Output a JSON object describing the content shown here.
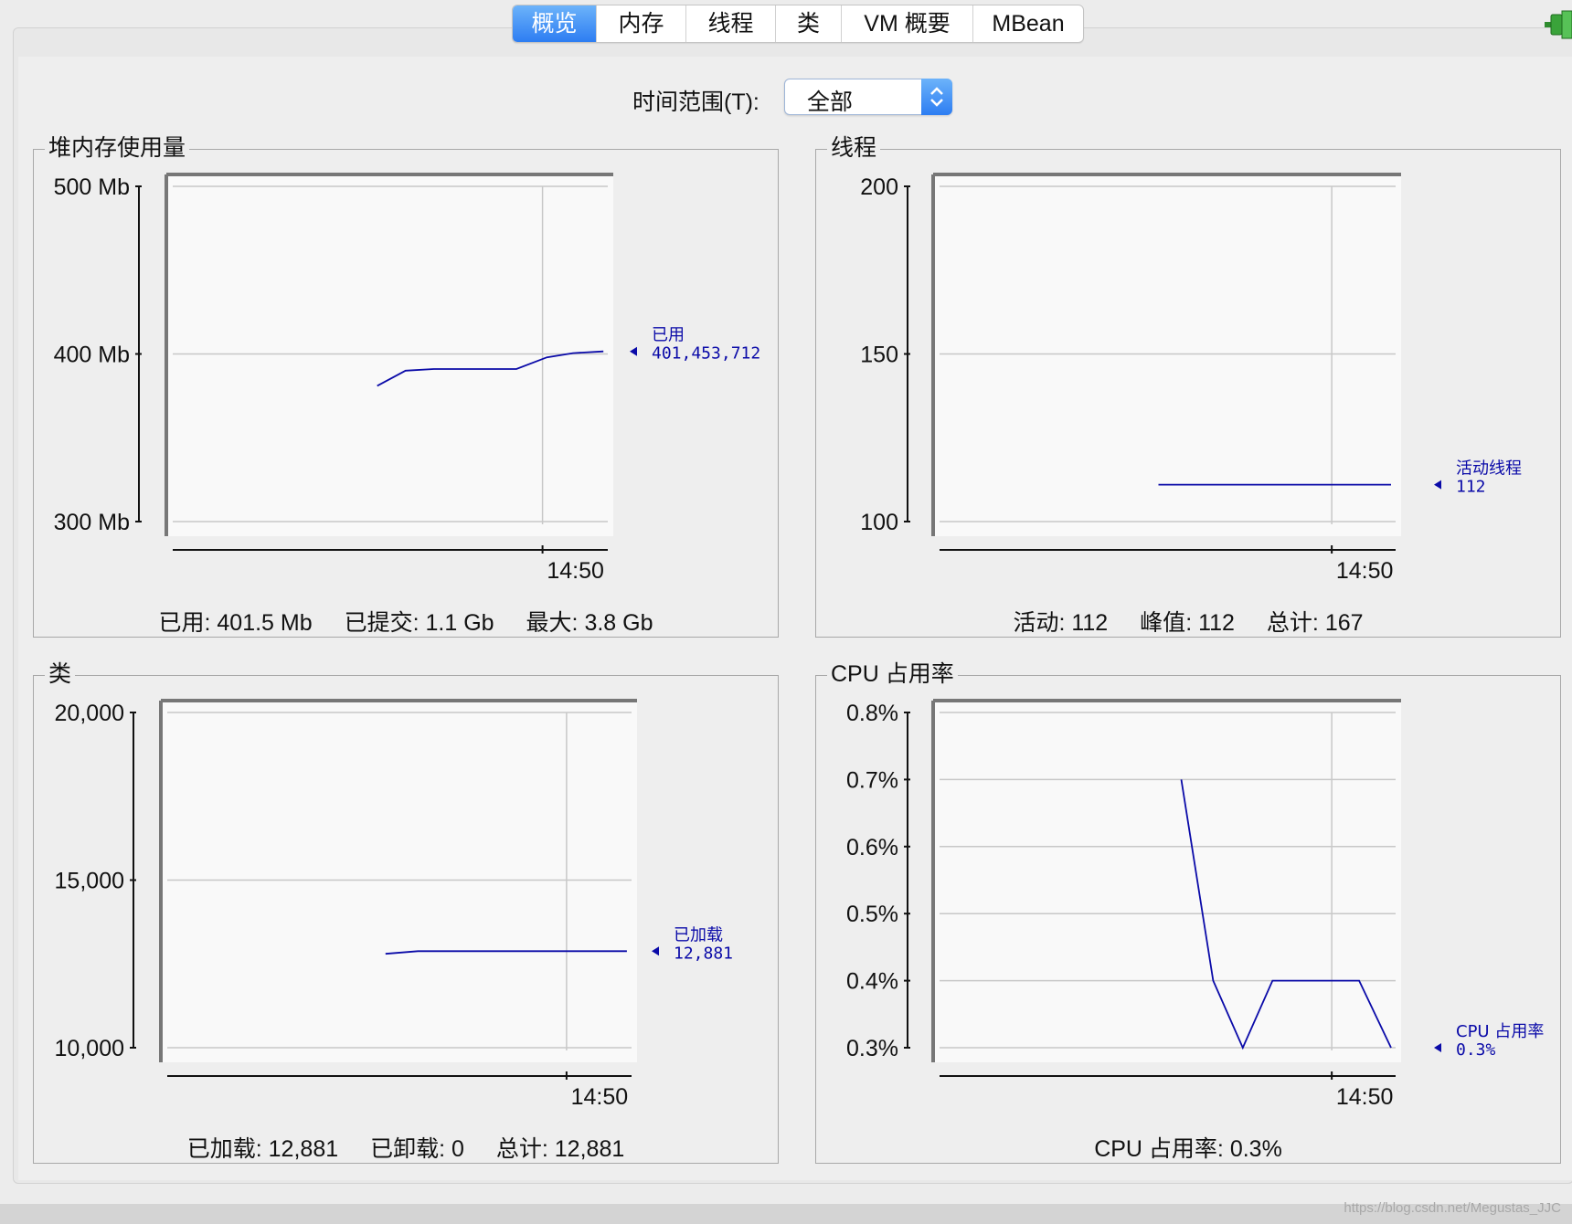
{
  "tabs": [
    {
      "label": "概览",
      "active": true
    },
    {
      "label": "内存",
      "active": false
    },
    {
      "label": "线程",
      "active": false
    },
    {
      "label": "类",
      "active": false
    },
    {
      "label": "VM 概要",
      "active": false
    },
    {
      "label": "MBean",
      "active": false
    }
  ],
  "time_range": {
    "label": "时间范围(T):",
    "value": "全部"
  },
  "panels": {
    "heap": {
      "title": "堆内存使用量",
      "stats": [
        {
          "label": "已用",
          "value": "401.5 Mb"
        },
        {
          "label": "已提交",
          "value": "1.1 Gb"
        },
        {
          "label": "最大",
          "value": "3.8 Gb"
        }
      ]
    },
    "threads": {
      "title": "线程",
      "stats": [
        {
          "label": "活动",
          "value": "112"
        },
        {
          "label": "峰值",
          "value": "112"
        },
        {
          "label": "总计",
          "value": "167"
        }
      ]
    },
    "classes": {
      "title": "类",
      "stats": [
        {
          "label": "已加载",
          "value": "12,881"
        },
        {
          "label": "已卸载",
          "value": "0"
        },
        {
          "label": "总计",
          "value": "12,881"
        }
      ]
    },
    "cpu": {
      "title": "CPU 占用率",
      "stats": [
        {
          "label": "CPU 占用率",
          "value": "0.3%"
        }
      ]
    }
  },
  "watermark": "https://blog.csdn.net/Megustas_JJC",
  "colors": {
    "accent": "#2d7df2",
    "series": "#0a0aa8",
    "grid": "#c8c8c8",
    "plot_bg": "#f9f9f9"
  },
  "chart_data": [
    {
      "id": "heap",
      "type": "line",
      "yticks": [
        "300 Mb",
        "400 Mb",
        "500 Mb"
      ],
      "ylim": [
        300,
        500
      ],
      "xlim": [
        0,
        100
      ],
      "xtick": {
        "label": "14:50",
        "x": 85
      },
      "series": [
        {
          "name": "已用",
          "x": [
            47,
            53.5,
            60,
            79,
            86,
            92,
            99
          ],
          "y": [
            381,
            390,
            391,
            391,
            398,
            400.5,
            401.5
          ]
        }
      ],
      "end_label": "已用",
      "end_value": "401,453,712"
    },
    {
      "id": "threads",
      "type": "line",
      "yticks": [
        "100",
        "150",
        "200"
      ],
      "ylim": [
        100,
        200
      ],
      "xlim": [
        0,
        100
      ],
      "xtick": {
        "label": "14:50",
        "x": 86
      },
      "series": [
        {
          "name": "活动线程",
          "x": [
            48,
            99
          ],
          "y": [
            111,
            111
          ]
        }
      ],
      "end_label": "活动线程",
      "end_value": "112"
    },
    {
      "id": "classes",
      "type": "line",
      "yticks": [
        "10,000",
        "15,000",
        "20,000"
      ],
      "ylim": [
        10000,
        20000
      ],
      "xlim": [
        0,
        100
      ],
      "xtick": {
        "label": "14:50",
        "x": 86
      },
      "series": [
        {
          "name": "已加载",
          "x": [
            47,
            54,
            99
          ],
          "y": [
            12800,
            12881,
            12881
          ]
        }
      ],
      "end_label": "已加载",
      "end_value": "12,881"
    },
    {
      "id": "cpu",
      "type": "line",
      "yticks": [
        "0.3%",
        "0.4%",
        "0.5%",
        "0.6%",
        "0.7%",
        "0.8%"
      ],
      "ylim": [
        0.3,
        0.8
      ],
      "xlim": [
        0,
        100
      ],
      "xtick": {
        "label": "14:50",
        "x": 86
      },
      "series": [
        {
          "name": "CPU 占用率",
          "x": [
            53,
            60,
            66.5,
            73,
            86,
            92,
            99
          ],
          "y": [
            0.7,
            0.4,
            0.3,
            0.4,
            0.4,
            0.4,
            0.3
          ]
        }
      ],
      "end_label": "CPU 占用率",
      "end_value": "0.3%"
    }
  ]
}
